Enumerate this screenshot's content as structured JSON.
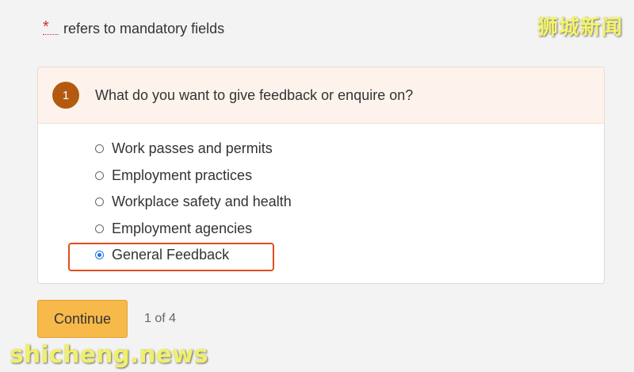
{
  "mandatory_note": {
    "star": "*",
    "text": "refers to mandatory fields"
  },
  "watermarks": {
    "top_right": "狮城新闻",
    "bottom_left": "shicheng.news"
  },
  "question": {
    "number": "1",
    "text": "What do you want to give feedback or enquire on?",
    "options": [
      {
        "label": "Work passes and permits",
        "selected": false
      },
      {
        "label": "Employment practices",
        "selected": false
      },
      {
        "label": "Workplace safety and health",
        "selected": false
      },
      {
        "label": "Employment agencies",
        "selected": false
      },
      {
        "label": "General Feedback",
        "selected": true
      }
    ]
  },
  "footer": {
    "continue_label": "Continue",
    "pager": "1 of 4"
  },
  "colors": {
    "accent_button": "#f7b94a",
    "step_badge": "#b35a10",
    "highlight": "#e04e1e",
    "radio_selected": "#1a73e8"
  }
}
